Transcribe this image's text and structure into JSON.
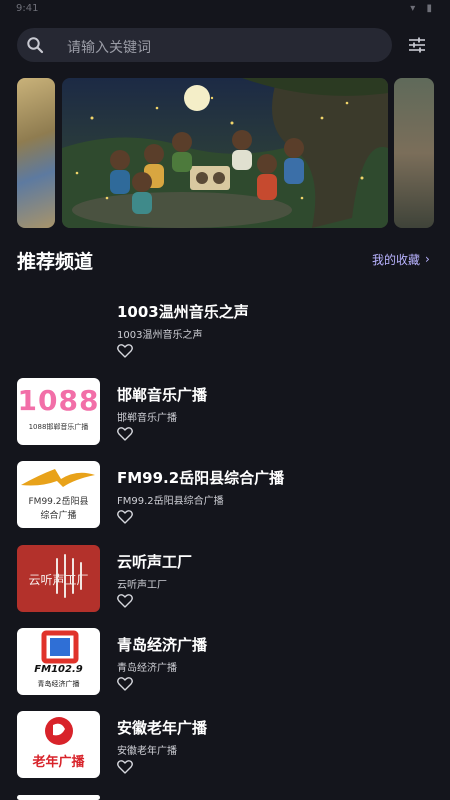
{
  "status_bar": {
    "time": "9:41"
  },
  "search": {
    "placeholder": "请输入关键词"
  },
  "icons": {
    "search": "search-icon",
    "filter": "sliders-icon",
    "favorite": "heart-outline-icon",
    "chevron": "chevron-right-icon"
  },
  "section": {
    "title": "推荐频道",
    "favorites_label": "我的收藏",
    "chevron": "›"
  },
  "colors": {
    "background": "#14151c",
    "search_bg": "#262833",
    "accent": "#b9b3ff"
  },
  "channels": [
    {
      "name": "1003温州音乐之声",
      "desc": "1003温州音乐之声",
      "logo_text": ""
    },
    {
      "name": "邯郸音乐广播",
      "desc": "邯郸音乐广播",
      "logo_text": "1088邯郸音乐广播",
      "logo_big": "1088"
    },
    {
      "name": "FM99.2岳阳县综合广播",
      "desc": "FM99.2岳阳县综合广播",
      "logo_text": "FM99.2岳阳县",
      "logo_text2": "综合广播"
    },
    {
      "name": "云听声工厂",
      "desc": "云听声工厂",
      "logo_text": "云听声工厂"
    },
    {
      "name": "青岛经济广播",
      "desc": "青岛经济广播",
      "logo_text": "FM102.9",
      "logo_text2": "青岛经济广播"
    },
    {
      "name": "安徽老年广播",
      "desc": "安徽老年广播",
      "logo_text": "老年广播"
    }
  ]
}
